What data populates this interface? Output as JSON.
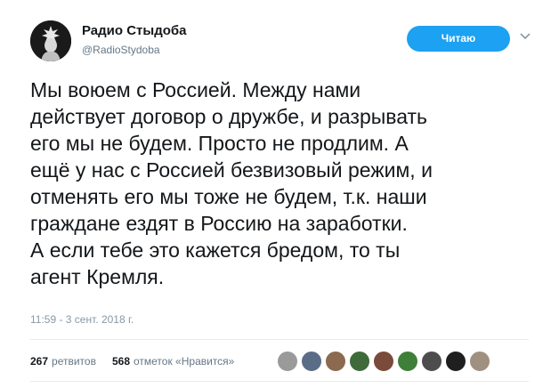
{
  "account": {
    "display_name": "Радио Стыдоба",
    "handle": "@RadioStydoba"
  },
  "follow_button": {
    "label": "Читаю"
  },
  "tweet": {
    "lines": [
      "Мы воюем с Россией. Между нами",
      "действует договор о дружбе, и разрывать",
      "его мы не будем. Просто не продлим. А",
      "ещё у нас с Россией безвизовый режим, и",
      "отменять его мы тоже не будем, т.к. наши",
      "граждане ездят в Россию на заработки.",
      "А если тебе это кажется бредом, то ты",
      "агент Кремля."
    ],
    "timestamp": "11:59 - 3 сент. 2018 г."
  },
  "stats": {
    "retweets_count": "267",
    "retweets_label": "ретвитов",
    "likes_count": "568",
    "likes_label": "отметок «Нравится»"
  },
  "likers": {
    "colors": [
      "#9a9a9a",
      "#5b6c86",
      "#8b6a4f",
      "#3f6b3a",
      "#7a4a3a",
      "#3e7f3a",
      "#4d4d4d",
      "#1f1f1f",
      "#a09080"
    ]
  },
  "icons": {
    "avatar": "statue-of-liberty-avatar",
    "chevron": "chevron-down-icon"
  }
}
